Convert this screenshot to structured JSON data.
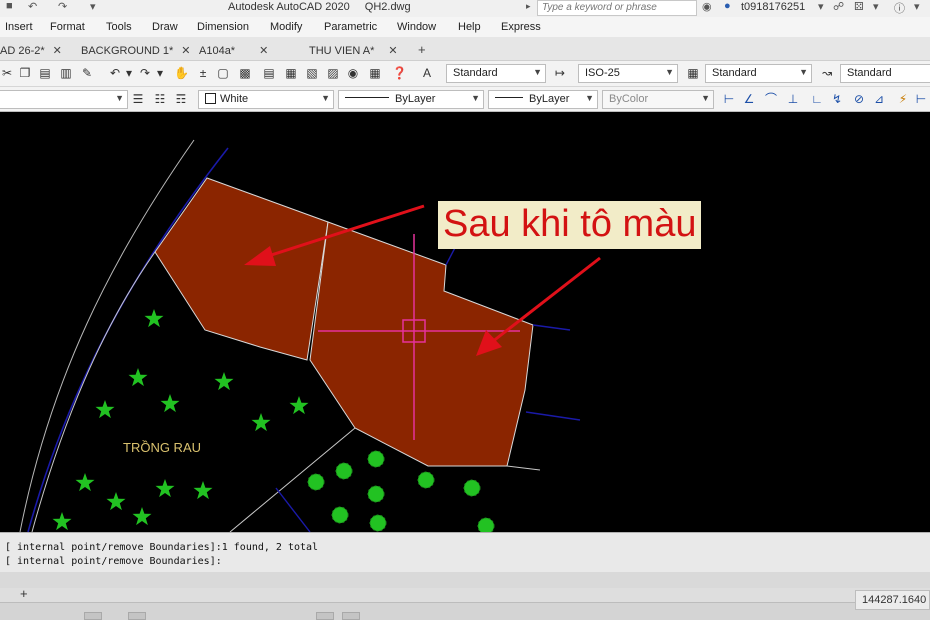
{
  "window": {
    "app_title": "Autodesk AutoCAD 2020",
    "file_name": "QH2.dwg",
    "search_placeholder": "Type a keyword or phrase",
    "user": "t0918176251"
  },
  "menu": [
    "Insert",
    "Format",
    "Tools",
    "Draw",
    "Dimension",
    "Modify",
    "Parametric",
    "Window",
    "Help",
    "Express"
  ],
  "tabs": [
    {
      "label": "AD 26-2*"
    },
    {
      "label": "BACKGROUND 1*"
    },
    {
      "label": "A104a*"
    },
    {
      "label": "THU VIEN A*"
    }
  ],
  "toolbar": {
    "text_style": "Standard",
    "dim_style": "ISO-25",
    "table_style": "Standard",
    "multileader_style": "Standard",
    "color": "White",
    "linetype": "ByLayer",
    "lineweight": "ByLayer",
    "plot_style": "ByColor"
  },
  "drawing": {
    "annotation": "Sau khi tô màu",
    "area_label": "TRỒNG RAU",
    "hatch_color": "#8b2500",
    "boundary_color": "#1a1aa8",
    "arrow_color": "#e0101a",
    "crosshair_color": "#e6329b",
    "tree_color": "#22c222"
  },
  "command": {
    "history": "[ internal point/remove Boundaries]:1 found, 2 total",
    "prompt": "[ internal point/remove Boundaries]:"
  },
  "status": {
    "coordinates": "144287.1640"
  }
}
